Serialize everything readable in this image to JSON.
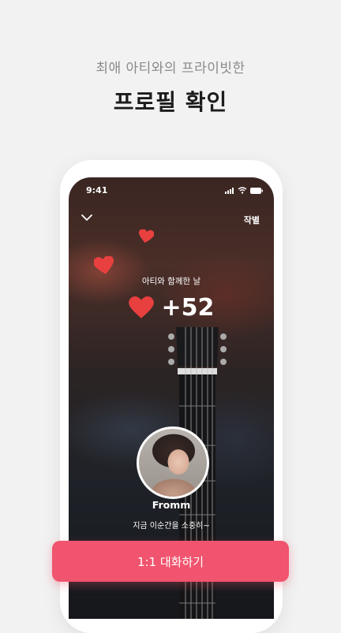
{
  "promo": {
    "subtitle": "최애 아티와의 프라이빗한",
    "title": "프로필 확인"
  },
  "phone": {
    "status_time": "9:41",
    "farewell_label": "작별",
    "together_label": "아티와 함께한 날",
    "heart_count": "+52",
    "artist_name": "Fromm",
    "status_message": "지금 이순간을 소중히~"
  },
  "cta": {
    "label": "1:1 대화하기"
  },
  "colors": {
    "accent": "#f0546e",
    "heart": "#e8403f"
  }
}
